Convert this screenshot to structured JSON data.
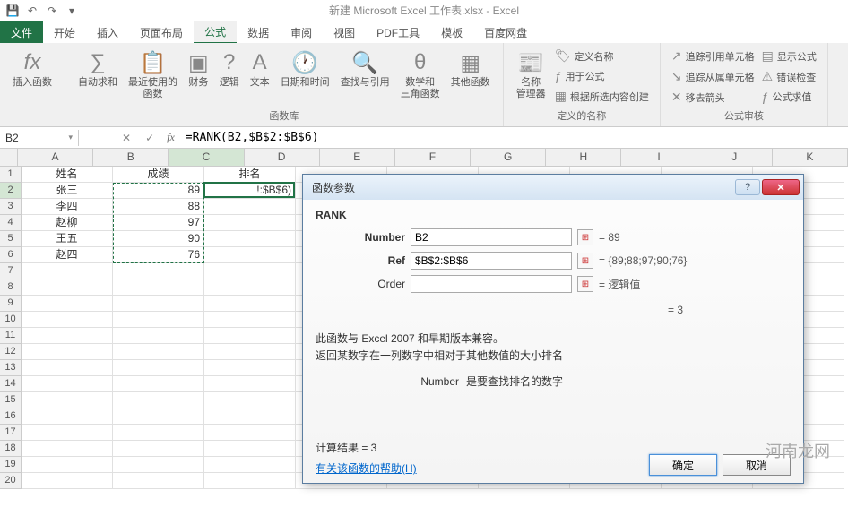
{
  "app_title": "新建 Microsoft Excel 工作表.xlsx - Excel",
  "tabs": {
    "file": "文件",
    "items": [
      "开始",
      "插入",
      "页面布局",
      "公式",
      "数据",
      "审阅",
      "视图",
      "PDF工具",
      "模板",
      "百度网盘"
    ],
    "active_index": 3
  },
  "ribbon": {
    "insert_function": "插入函数",
    "autosum": "自动求和",
    "recent": "最近使用的\n函数",
    "financial": "财务",
    "logical": "逻辑",
    "text": "文本",
    "datetime": "日期和时间",
    "lookup": "查找与引用",
    "math": "数学和\n三角函数",
    "more": "其他函数",
    "name_mgr": "名称\n管理器",
    "define_name": "定义名称",
    "use_in_formula": "用于公式",
    "create_from_sel": "根据所选内容创建",
    "trace_prec": "追踪引用单元格",
    "trace_dep": "追踪从属单元格",
    "remove_arrows": "移去箭头",
    "show_formulas": "显示公式",
    "error_check": "错误检查",
    "eval_formula": "公式求值",
    "group_lib": "函数库",
    "group_names": "定义的名称",
    "group_audit": "公式审核"
  },
  "name_box": "B2",
  "formula": "=RANK(B2,$B$2:$B$6)",
  "cols": [
    "A",
    "B",
    "C",
    "D",
    "E",
    "F",
    "G",
    "H",
    "I",
    "J",
    "K"
  ],
  "rows": 20,
  "active_col": 2,
  "active_row": 2,
  "table": {
    "headers": [
      "姓名",
      "成绩",
      "排名"
    ],
    "data": [
      [
        "张三",
        89,
        "!:$B$6)"
      ],
      [
        "李四",
        88,
        ""
      ],
      [
        "赵柳",
        97,
        ""
      ],
      [
        "王五",
        90,
        ""
      ],
      [
        "赵四",
        76,
        ""
      ]
    ]
  },
  "dialog": {
    "title": "函数参数",
    "func_name": "RANK",
    "args": [
      {
        "label": "Number",
        "value": "B2",
        "result": "= 89",
        "bold": true
      },
      {
        "label": "Ref",
        "value": "$B$2:$B$6",
        "result": "= {89;88;97;90;76}",
        "bold": true
      },
      {
        "label": "Order",
        "value": "",
        "result": "= 逻辑值",
        "bold": false
      }
    ],
    "calc_preview": "= 3",
    "desc1": "此函数与 Excel 2007 和早期版本兼容。",
    "desc2": "返回某数字在一列数字中相对于其他数值的大小排名",
    "arg_desc_name": "Number",
    "arg_desc_text": "是要查找排名的数字",
    "result_label": "计算结果 = 3",
    "help_link": "有关该函数的帮助(H)",
    "ok": "确定",
    "cancel": "取消"
  },
  "watermark": "河南龙网"
}
